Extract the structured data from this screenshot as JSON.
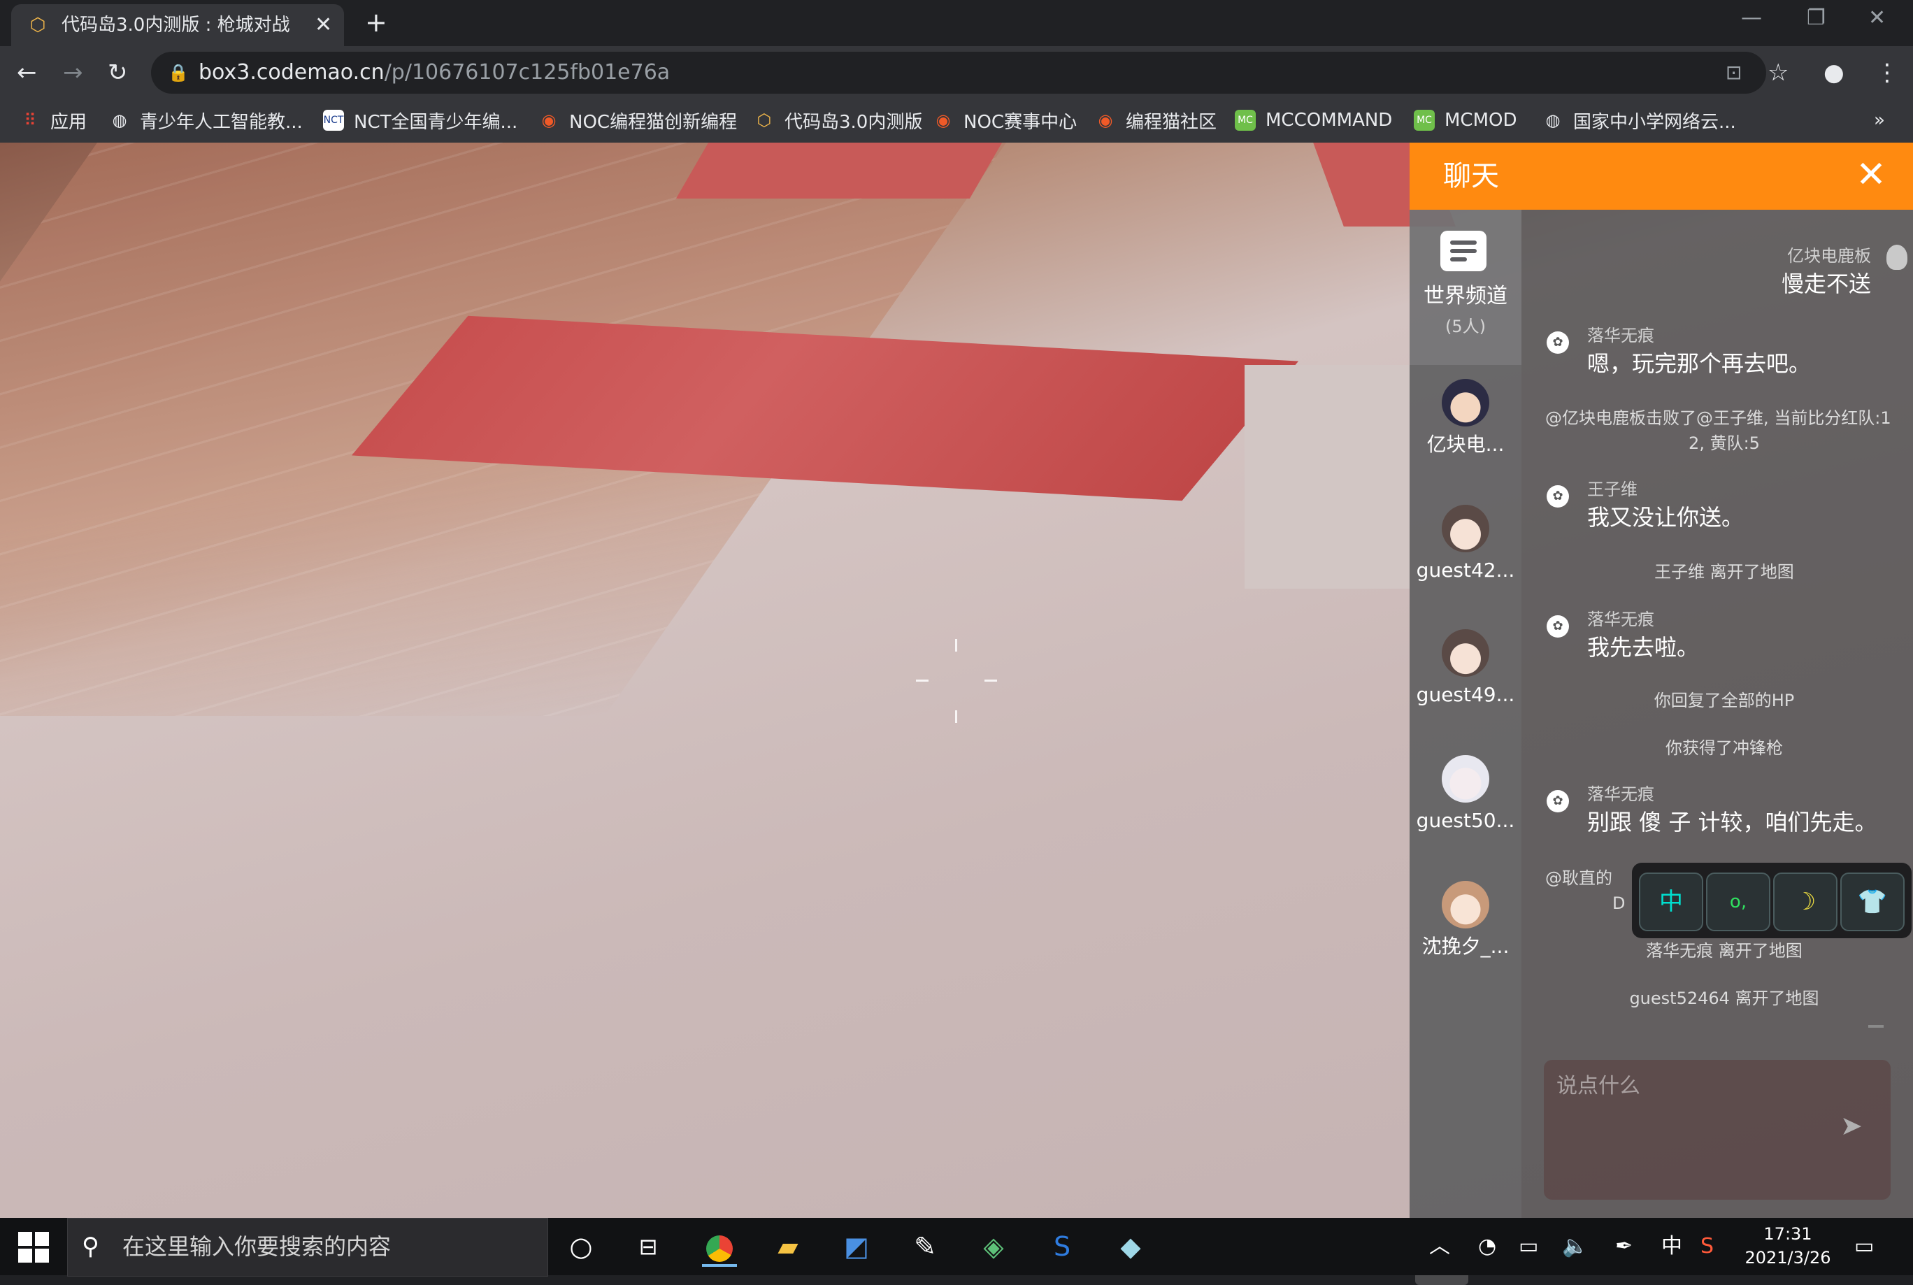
{
  "browser": {
    "tab_title": "代码岛3.0内测版 : 枪城对战",
    "url_host": "box3.codemao.cn",
    "url_path": "/p/10676107c125fb01e76a",
    "bookmarks": [
      {
        "label": "应用",
        "icon": "apps-grid-icon"
      },
      {
        "label": "青少年人工智能教...",
        "icon": "globe-icon"
      },
      {
        "label": "NCT全国青少年编...",
        "icon": "nct-logo-icon"
      },
      {
        "label": "NOC编程猫创新编程",
        "icon": "codemao-icon"
      },
      {
        "label": "代码岛3.0内测版",
        "icon": "box3-icon"
      },
      {
        "label": "NOC赛事中心",
        "icon": "codemao-icon"
      },
      {
        "label": "编程猫社区",
        "icon": "codemao-icon"
      },
      {
        "label": "MCCOMMAND",
        "icon": "mc-icon"
      },
      {
        "label": "MCMOD",
        "icon": "mc-icon"
      },
      {
        "label": "国家中小学网络云...",
        "icon": "globe-icon"
      }
    ],
    "bookmarks_more": "»"
  },
  "chat": {
    "title": "聊天",
    "channel": {
      "name": "世界频道",
      "count": "(5人)"
    },
    "members": [
      {
        "name": "亿块电..."
      },
      {
        "name": "guest42..."
      },
      {
        "name": "guest49..."
      },
      {
        "name": "guest50..."
      },
      {
        "name": "沈挽夕_..."
      }
    ],
    "messages": [
      {
        "type": "right",
        "sender": "亿块电鹿板",
        "text": "慢走不送"
      },
      {
        "type": "left",
        "sender": "落华无痕",
        "text": "嗯，玩完那个再去吧。"
      },
      {
        "type": "system",
        "text": "@亿块电鹿板击败了@王子维, 当前比分红队:1"
      },
      {
        "type": "system_cont",
        "text": "2, 黄队:5"
      },
      {
        "type": "left",
        "sender": "王子维",
        "text": "我又没让你送。"
      },
      {
        "type": "system",
        "text": "王子维 离开了地图"
      },
      {
        "type": "left",
        "sender": "落华无痕",
        "text": "我先去啦。"
      },
      {
        "type": "system",
        "text": "你回复了全部的HP"
      },
      {
        "type": "system",
        "text": "你获得了冲锋枪"
      },
      {
        "type": "left",
        "sender": "落华无痕",
        "text": "别跟 傻 子 计较，咱们先走。"
      },
      {
        "type": "system_partial",
        "text": "@耿直的"
      },
      {
        "type": "system_partial2",
        "text": "D"
      },
      {
        "type": "system",
        "text": "落华无痕 离开了地图"
      },
      {
        "type": "system",
        "text": "guest52464 离开了地图"
      }
    ],
    "emoji_keys": [
      "中",
      "o,",
      "☽",
      "👕"
    ],
    "input_placeholder": "说点什么",
    "close_icon": "close-icon",
    "send_icon": "send-arrow-icon"
  },
  "taskbar": {
    "search_placeholder": "在这里输入你要搜索的内容",
    "ime": "中",
    "time": "17:31",
    "date": "2021/3/26"
  },
  "colors": {
    "chat_header": "#ff8a10",
    "red_floor": "#c85a58",
    "browser_bg": "#35363a"
  }
}
